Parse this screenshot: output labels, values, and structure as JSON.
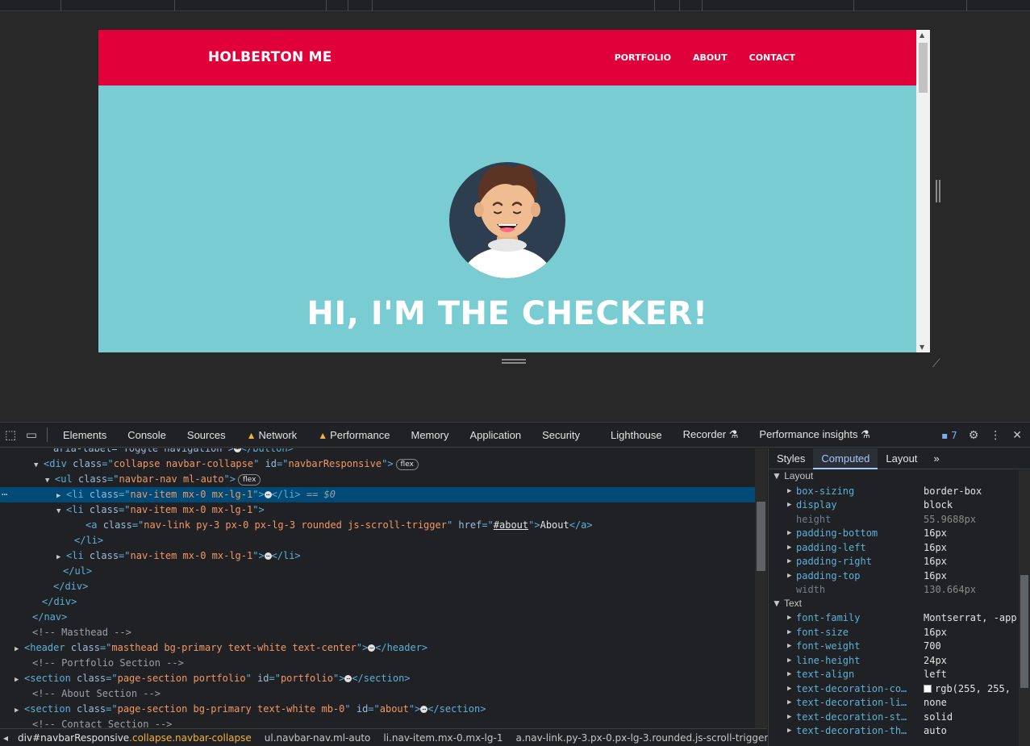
{
  "site": {
    "brand": "HOLBERTON ME",
    "nav": [
      "PORTFOLIO",
      "ABOUT",
      "CONTACT"
    ],
    "hero_title": "HI, I'M THE CHECKER!",
    "colors": {
      "nav_bg": "#e0013a",
      "masthead_bg": "#78ccd2"
    }
  },
  "devtools": {
    "tabs": [
      "Elements",
      "Console",
      "Sources",
      "Network",
      "Performance",
      "Memory",
      "Application",
      "Security",
      "Lighthouse",
      "Recorder",
      "Performance insights"
    ],
    "active_tab": "Elements",
    "issues_count": "7",
    "dom_lines": [
      {
        "pre": "aria-label=\"Toggle navigation\">",
        "post": "</button>"
      },
      {
        "tag": "<div",
        "attrs": [
          [
            "class",
            "collapse navbar-collapse"
          ],
          [
            "id",
            "navbarResponsive"
          ]
        ],
        "pill": "flex"
      },
      {
        "tag": "<ul",
        "attrs": [
          [
            "class",
            "navbar-nav ml-auto"
          ]
        ],
        "pill": "flex"
      },
      {
        "tag": "<li",
        "attrs": [
          [
            "class",
            "nav-item mx-0 mx-lg-1"
          ]
        ],
        "close": "</li>",
        "eq": "== $0"
      },
      {
        "tag": "<li",
        "attrs": [
          [
            "class",
            "nav-item mx-0 mx-lg-1"
          ]
        ]
      },
      {
        "tag": "<a",
        "attrs": [
          [
            "class",
            "nav-link py-3 px-0 px-lg-3 rounded js-scroll-trigger"
          ],
          [
            "href",
            "#about"
          ]
        ],
        "text": "About",
        "close": "</a>"
      },
      {
        "close_only": "</li>"
      },
      {
        "tag": "<li",
        "attrs": [
          [
            "class",
            "nav-item mx-0 mx-lg-1"
          ]
        ],
        "close": "</li>"
      },
      {
        "close_only": "</ul>"
      },
      {
        "close_only": "</div>"
      },
      {
        "close_only": "</div>"
      },
      {
        "close_only": "</nav>"
      },
      {
        "comment": "<!-- Masthead -->"
      },
      {
        "tag": "<header",
        "attrs": [
          [
            "class",
            "masthead bg-primary text-white text-center"
          ]
        ],
        "close": "</header>"
      },
      {
        "comment": "<!-- Portfolio Section -->"
      },
      {
        "tag": "<section",
        "attrs": [
          [
            "class",
            "page-section portfolio"
          ],
          [
            "id",
            "portfolio"
          ]
        ],
        "close": "</section>"
      },
      {
        "comment": "<!-- About Section -->"
      },
      {
        "tag": "<section",
        "attrs": [
          [
            "class",
            "page-section bg-primary text-white mb-0"
          ],
          [
            "id",
            "about"
          ]
        ],
        "close": "</section>"
      },
      {
        "comment": "<!-- Contact Section -->"
      }
    ],
    "breadcrumbs": [
      {
        "id": "div#navbarResponsive",
        "cls": ".collapse.navbar-collapse"
      },
      {
        "id": "ul",
        "cls": ".navbar-nav.ml-auto"
      },
      {
        "id": "li",
        "cls": ".nav-item.mx-0.mx-lg-1"
      },
      {
        "id": "a",
        "cls": ".nav-link.py-3.px-0.px-lg-3.rounded.js-scroll-trigger"
      }
    ],
    "side_tabs": [
      "Styles",
      "Computed",
      "Layout"
    ],
    "side_active": "Computed",
    "computed": {
      "layout_label": "Layout",
      "layout": [
        {
          "name": "box-sizing",
          "value": "border-box"
        },
        {
          "name": "display",
          "value": "block"
        },
        {
          "name": "height",
          "value": "55.9688px",
          "dim": true
        },
        {
          "name": "padding-bottom",
          "value": "16px"
        },
        {
          "name": "padding-left",
          "value": "16px"
        },
        {
          "name": "padding-right",
          "value": "16px"
        },
        {
          "name": "padding-top",
          "value": "16px"
        },
        {
          "name": "width",
          "value": "130.664px",
          "dim": true
        }
      ],
      "text_label": "Text",
      "text": [
        {
          "name": "font-family",
          "value": "Montserrat, -app"
        },
        {
          "name": "font-size",
          "value": "16px"
        },
        {
          "name": "font-weight",
          "value": "700"
        },
        {
          "name": "line-height",
          "value": "24px"
        },
        {
          "name": "text-align",
          "value": "left"
        },
        {
          "name": "text-decoration-co…",
          "value": "rgb(255, 255,",
          "swatch": true
        },
        {
          "name": "text-decoration-li…",
          "value": "none"
        },
        {
          "name": "text-decoration-st…",
          "value": "solid"
        },
        {
          "name": "text-decoration-th…",
          "value": "auto"
        }
      ]
    }
  }
}
